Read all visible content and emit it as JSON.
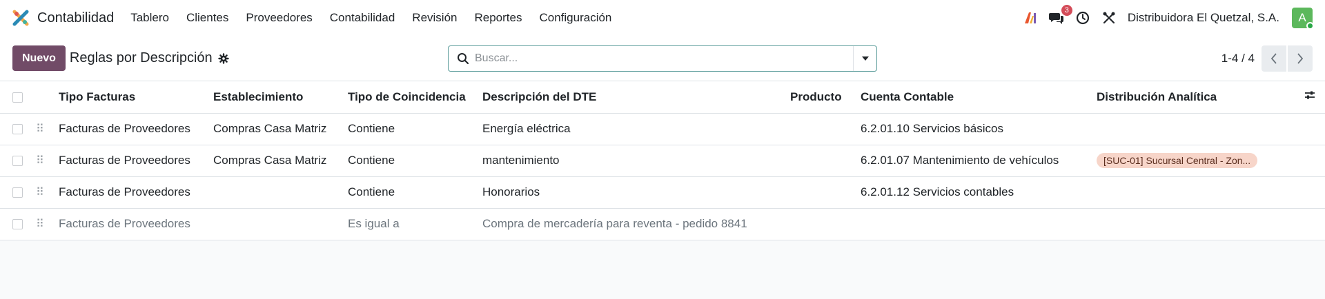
{
  "navbar": {
    "app_name": "Contabilidad",
    "menu": [
      "Tablero",
      "Clientes",
      "Proveedores",
      "Contabilidad",
      "Revisión",
      "Reportes",
      "Configuración"
    ],
    "messages_count": "3",
    "company": "Distribuidora El Quetzal, S.A.",
    "avatar_letter": "A",
    "colors": {
      "accent": "#714b67",
      "badge": "#d44c59",
      "avatar": "#5cb85c"
    },
    "icons": [
      "ai-icon",
      "chat-icon",
      "clock-icon",
      "tools-icon"
    ]
  },
  "control": {
    "new_label": "Nuevo",
    "title": "Reglas por Descripción",
    "search_placeholder": "Buscar...",
    "pager": "1-4 / 4"
  },
  "table": {
    "columns": [
      "Tipo Facturas",
      "Establecimiento",
      "Tipo de Coincidencia",
      "Descripción del DTE",
      "Producto",
      "Cuenta Contable",
      "Distribución Analítica"
    ],
    "rows": [
      {
        "tipo": "Facturas de Proveedores",
        "establecimiento": "Compras Casa Matriz",
        "coincidencia": "Contiene",
        "descripcion": "Energía eléctrica",
        "producto": "",
        "cuenta": "6.2.01.10 Servicios básicos",
        "analitica": ""
      },
      {
        "tipo": "Facturas de Proveedores",
        "establecimiento": "Compras Casa Matriz",
        "coincidencia": "Contiene",
        "descripcion": "mantenimiento",
        "producto": "",
        "cuenta": "6.2.01.07 Mantenimiento de vehículos",
        "analitica": "[SUC-01] Sucursal Central - Zon..."
      },
      {
        "tipo": "Facturas de Proveedores",
        "establecimiento": "",
        "coincidencia": "Contiene",
        "descripcion": "Honorarios",
        "producto": "",
        "cuenta": "6.2.01.12 Servicios contables",
        "analitica": ""
      },
      {
        "tipo": "Facturas de Proveedores",
        "establecimiento": "",
        "coincidencia": "Es igual a",
        "descripcion": "Compra de mercadería para reventa - pedido 8841",
        "producto": "",
        "cuenta": "",
        "analitica": ""
      }
    ]
  }
}
